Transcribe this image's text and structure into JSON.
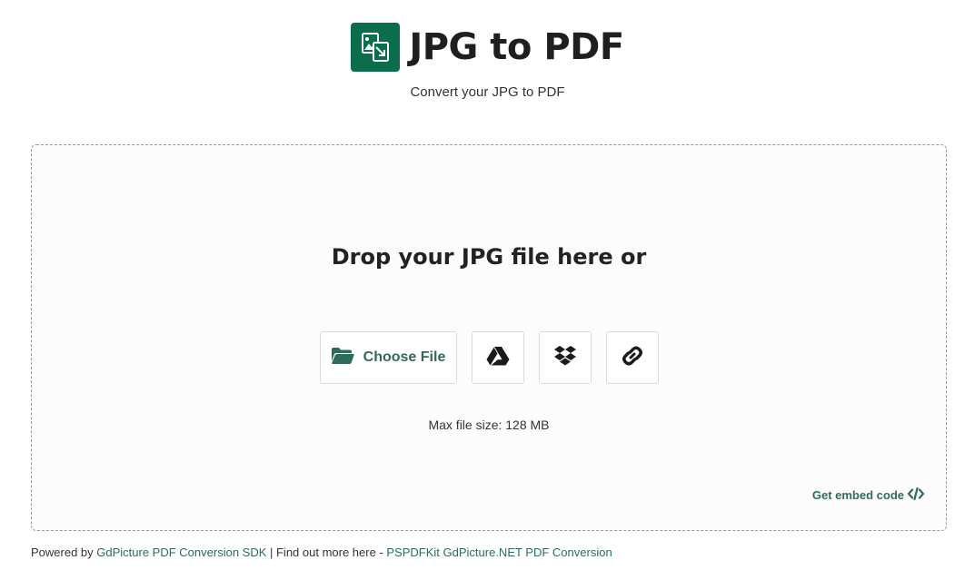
{
  "header": {
    "title": "JPG to PDF",
    "subtitle": "Convert your JPG to PDF",
    "logo_icon": "image-convert-icon"
  },
  "dropzone": {
    "heading": "Drop your JPG file here or",
    "choose_file_label": "Choose File",
    "buttons": [
      {
        "name": "choose-file-button",
        "icon": "folder-open-icon"
      },
      {
        "name": "google-drive-button",
        "icon": "google-drive-icon"
      },
      {
        "name": "dropbox-button",
        "icon": "dropbox-icon"
      },
      {
        "name": "url-link-button",
        "icon": "link-icon"
      }
    ],
    "max_size": "Max file size: 128 MB",
    "embed_label": "Get embed code"
  },
  "footer": {
    "prefix": "Powered by ",
    "sdk_link": "GdPicture PDF Conversion SDK",
    "middle": " | Find out more here - ",
    "product_link": "PSPDFKit GdPicture.NET PDF Conversion"
  },
  "colors": {
    "brand": "#0b6e4a",
    "link": "#2e6b5a",
    "dropzone_bg": "#fdfcfd"
  }
}
